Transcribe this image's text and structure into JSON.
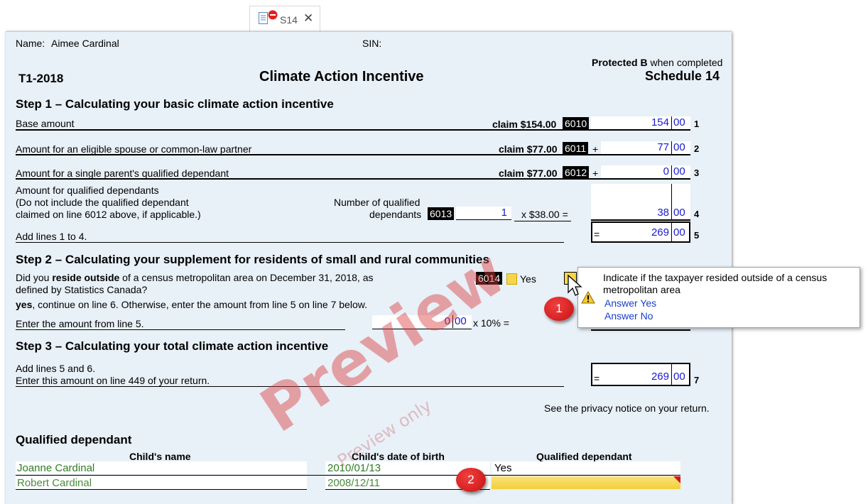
{
  "tab": {
    "label": "S14",
    "close": "✕"
  },
  "header": {
    "name_label": "Name:",
    "name_value": "Aimee Cardinal",
    "sin_label": "SIN:",
    "protected_bold": "Protected B",
    "protected_rest": "when completed",
    "form_id": "T1-2018",
    "title": "Climate Action Incentive",
    "schedule": "Schedule 14"
  },
  "step1": {
    "heading": "Step 1 – Calculating your basic climate action incentive",
    "line1": {
      "label": "Base amount",
      "claim": "claim $154.00",
      "code": "6010",
      "sign": "",
      "dollars": "154",
      "cents": "00",
      "num": "1"
    },
    "line2": {
      "label": "Amount for an eligible spouse or common-law partner",
      "claim": "claim $77.00",
      "code": "6011",
      "sign": "+",
      "dollars": "77",
      "cents": "00",
      "num": "2"
    },
    "line3": {
      "label": "Amount for a single parent's qualified dependant",
      "claim": "claim $77.00",
      "code": "6012",
      "sign": "+",
      "dollars": "0",
      "cents": "00",
      "num": "3"
    },
    "line4": {
      "label_l1": "Amount for qualified dependants",
      "label_l2": "(Do not include the qualified dependant",
      "label_l3": "claimed on line 6012 above, if applicable.)",
      "count_l1": "Number of qualified",
      "count_l2": "dependants",
      "code": "6013",
      "count": "1",
      "multiplier": "x $38.00 =",
      "sign": "+",
      "dollars": "38",
      "cents": "00",
      "num": "4"
    },
    "line5": {
      "label": "Add lines 1 to 4.",
      "sign": "=",
      "dollars": "269",
      "cents": "00",
      "num": "5"
    }
  },
  "step2": {
    "heading": "Step 2 – Calculating your supplement for residents of small and rural communities",
    "q_pre": "Did you",
    "q_bold": "reside outside",
    "q_post": "of a census metropolitan area on December 31, 2018, as",
    "q_line2": "defined by Statistics Canada?",
    "code": "6014",
    "yes_label": "Yes",
    "if_bold": "yes",
    "if_rest": ", continue on line 6. Otherwise, enter the amount from line 5 on line 7 below.",
    "enter_label": "Enter the amount from line 5.",
    "dollars": "0",
    "cents": "00",
    "multiplier": "x 10% ="
  },
  "popup": {
    "text_l1": "Indicate if the taxpayer resided outside of a census",
    "text_l2": "metropolitan area",
    "answer_yes": "Answer Yes",
    "answer_no": "Answer No"
  },
  "step3": {
    "heading": "Step 3 – Calculating your total climate action incentive",
    "label_l1": "Add lines 5 and 6.",
    "label_l2": "Enter this amount on line 449 of your return.",
    "sign": "=",
    "dollars": "269",
    "cents": "00",
    "num": "7"
  },
  "privacy": "See the privacy notice on your return.",
  "dependants": {
    "heading": "Qualified dependant",
    "col_name": "Child's name",
    "col_dob": "Child's date of birth",
    "col_qualified": "Qualified dependant",
    "rows": [
      {
        "name": "Joanne Cardinal",
        "dob": "2010/01/13",
        "qualified": "Yes"
      },
      {
        "name": "Robert Cardinal",
        "dob": "2008/12/11",
        "qualified": ""
      }
    ]
  },
  "badges": {
    "one": "1",
    "two": "2"
  },
  "watermark": {
    "main": "Preview",
    "sub": "Preview only"
  },
  "colors": {
    "form_bg": "#e8f0f8",
    "value_blue": "#1a1ad0",
    "green_text": "#2e7d22",
    "warning_yellow": "#f7d54a",
    "badge_red": "#d01818"
  }
}
